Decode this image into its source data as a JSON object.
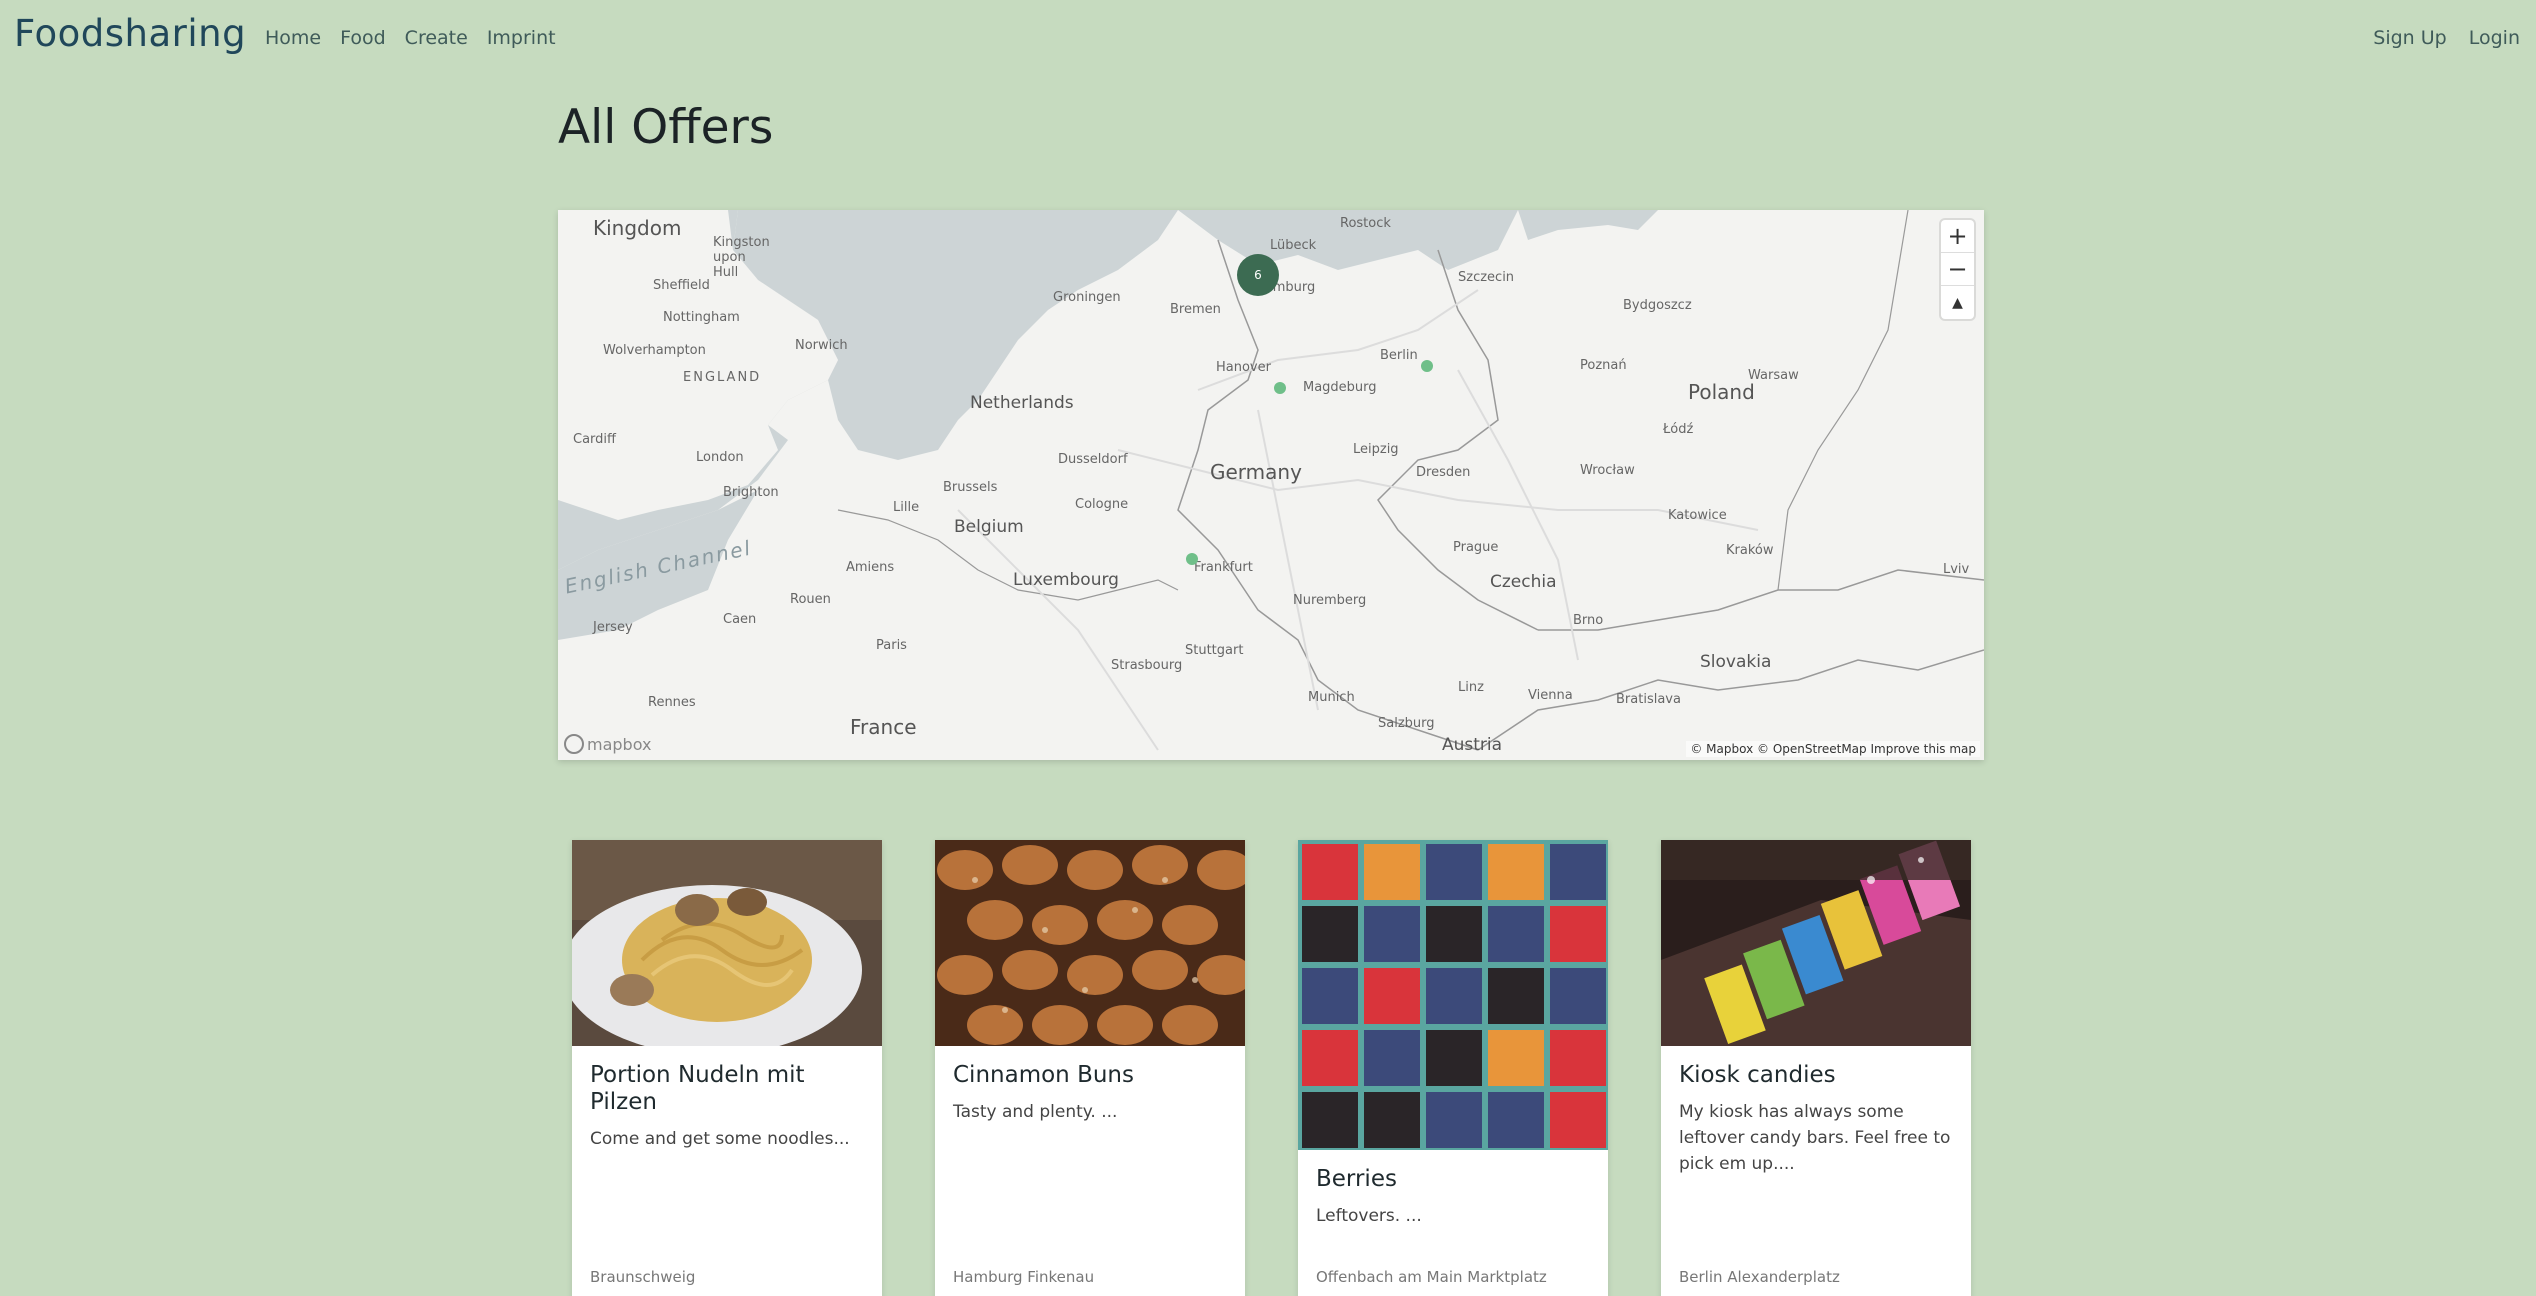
{
  "nav": {
    "brand": "Foodsharing",
    "links": [
      "Home",
      "Food",
      "Create",
      "Imprint"
    ],
    "right_links": [
      "Sign Up",
      "Login"
    ]
  },
  "page": {
    "title": "All Offers"
  },
  "map": {
    "cluster_count": "6",
    "attribution": "© Mapbox © OpenStreetMap Improve this map",
    "logo_text": "mapbox",
    "controls": {
      "zoom_in": "+",
      "zoom_out": "−",
      "reset": "▲"
    },
    "countries": [
      "Kingdom",
      "ENGLAND",
      "Netherlands",
      "Belgium",
      "Luxembourg",
      "Germany",
      "Poland",
      "Czechia",
      "Slovakia",
      "Austria",
      "France"
    ],
    "cities": [
      "Kingston upon Hull",
      "Sheffield",
      "Nottingham",
      "Norwich",
      "Wolverhampton",
      "Cardiff",
      "London",
      "Brighton",
      "Jersey",
      "Bremen",
      "Hamburg",
      "Lübeck",
      "Rostock",
      "Hanover",
      "Magdeburg",
      "Berlin",
      "Leipzig",
      "Dresden",
      "Dusseldorf",
      "Cologne",
      "Brussels",
      "Frankfurt",
      "Nuremberg",
      "Stuttgart",
      "Munich",
      "Prague",
      "Vienna",
      "Bratislava",
      "Wrocław",
      "Poznań",
      "Warsaw",
      "Kraków",
      "Szczecin",
      "Paris",
      "Rouen",
      "Caen",
      "Rennes",
      "Strasbourg",
      "Amiens",
      "Groningen",
      "Bydgoszcz",
      "Lille",
      "Salzburg",
      "Linz",
      "Brno",
      "Katowice",
      "Łódź",
      "Lviv"
    ],
    "sea": "English Channel"
  },
  "cards": [
    {
      "title": "Portion Nudeln mit Pilzen",
      "description": "Come and get some noodles...",
      "location": "Braunschweig",
      "image": "pasta"
    },
    {
      "title": "Cinnamon Buns",
      "description": "Tasty and plenty. ...",
      "location": "Hamburg Finkenau",
      "image": "pastry"
    },
    {
      "title": "Berries",
      "description": "Leftovers. ...",
      "location": "Offenbach am Main Marktplatz",
      "image": "berries"
    },
    {
      "title": "Kiosk candies",
      "description": "My kiosk has always some leftover candy bars. Feel free to pick em up....",
      "location": "Berlin Alexanderplatz",
      "image": "candies"
    }
  ]
}
